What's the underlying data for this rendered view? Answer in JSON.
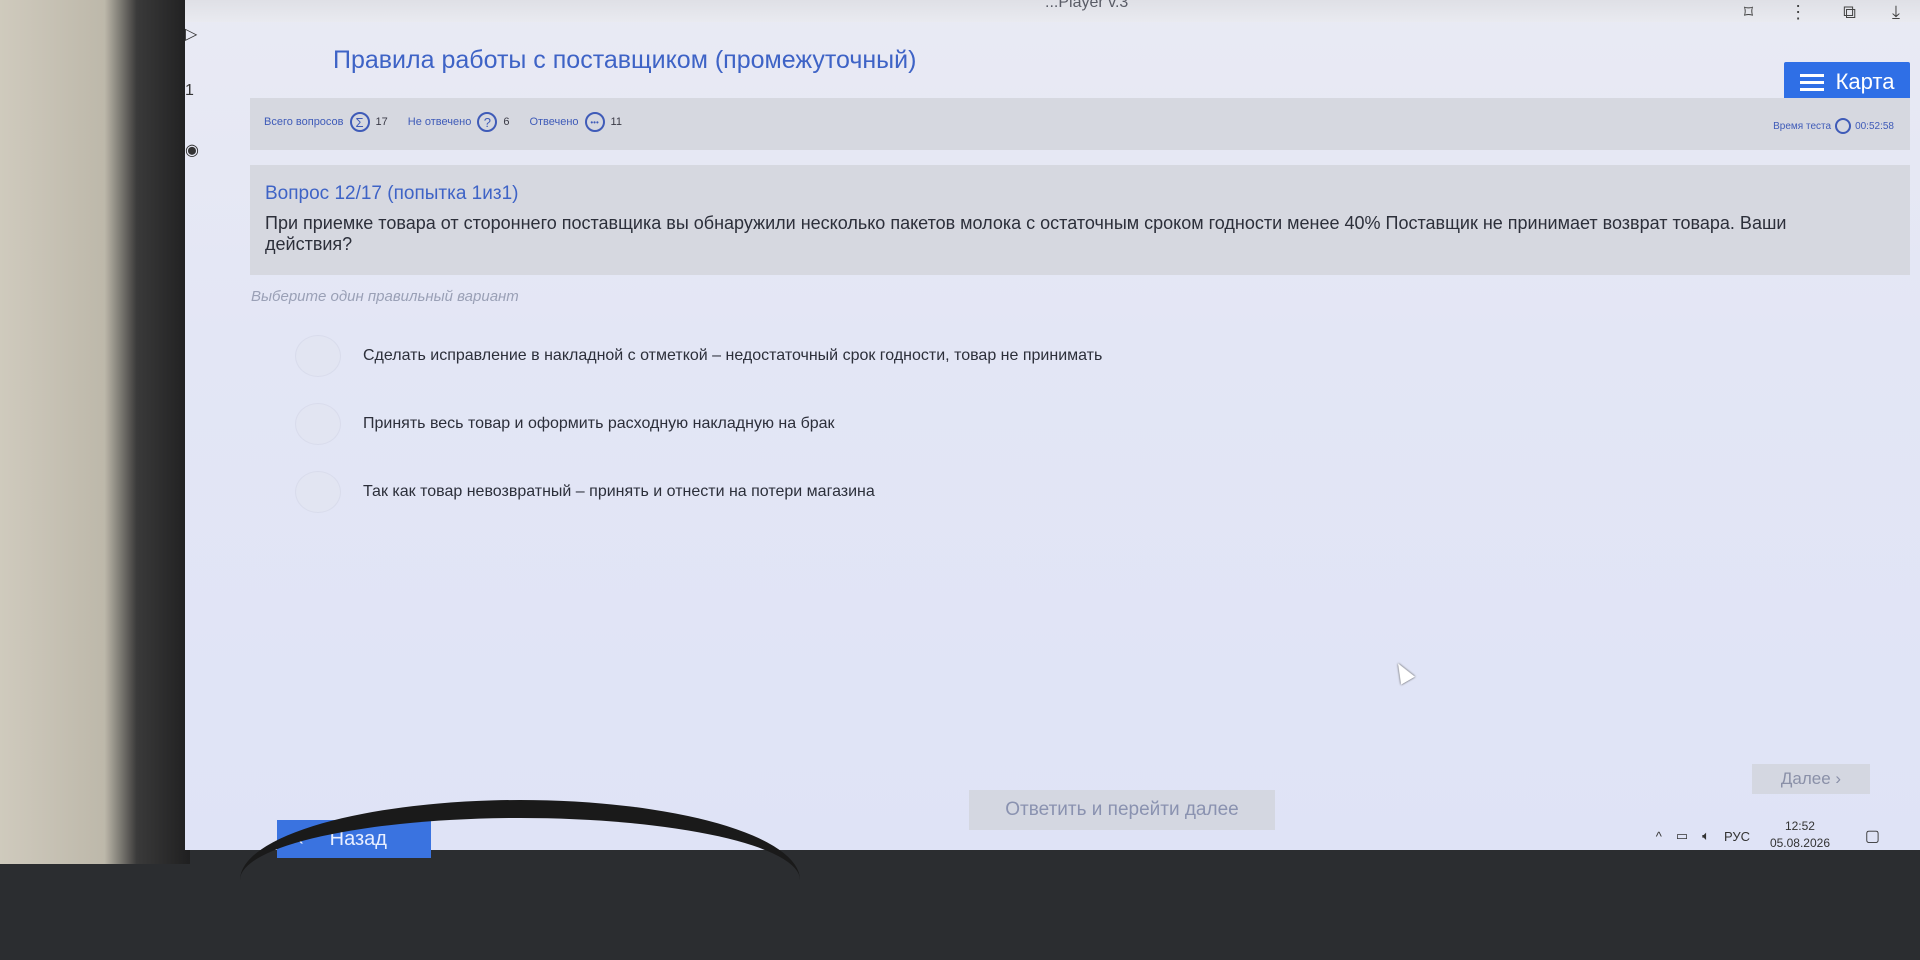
{
  "browser": {
    "title_fragment": "...Player v.3"
  },
  "side_strip": {
    "badge": "1"
  },
  "page": {
    "title": "Правила работы с поставщиком (промежуточный)"
  },
  "header": {
    "map_label": "Карта"
  },
  "stats": {
    "total_label": "Всего вопросов",
    "total_icon": "Σ",
    "total_value": "17",
    "unanswered_label": "Не отвечено",
    "unanswered_icon": "?",
    "unanswered_value": "6",
    "answered_label": "Отвечено",
    "answered_icon": "•••",
    "answered_value": "11",
    "timer_label": "Время теста",
    "timer_value": "00:52:58"
  },
  "question": {
    "number": "Вопрос 12/17",
    "attempt": "(попытка 1из1)",
    "text": "При приемке товара от стороннего поставщика вы обнаружили несколько пакетов молока с остаточным сроком годности менее 40% Поставщик не принимает возврат товара. Ваши действия?"
  },
  "hint": "Выберите один правильный вариант",
  "options": [
    {
      "label": "Сделать исправление в накладной с отметкой – недостаточный срок годности, товар не принимать"
    },
    {
      "label": "Принять весь товар и оформить расходную накладную на брак"
    },
    {
      "label": "Так как товар невозвратный – принять и отнести на потери магазина"
    }
  ],
  "footer": {
    "next_label": "Далее",
    "answer_next_label": "Ответить и перейти далее",
    "back_label": "Назад"
  },
  "taskbar": {
    "lang": "РУС",
    "time": "12:52",
    "date": "05.08.2026"
  }
}
